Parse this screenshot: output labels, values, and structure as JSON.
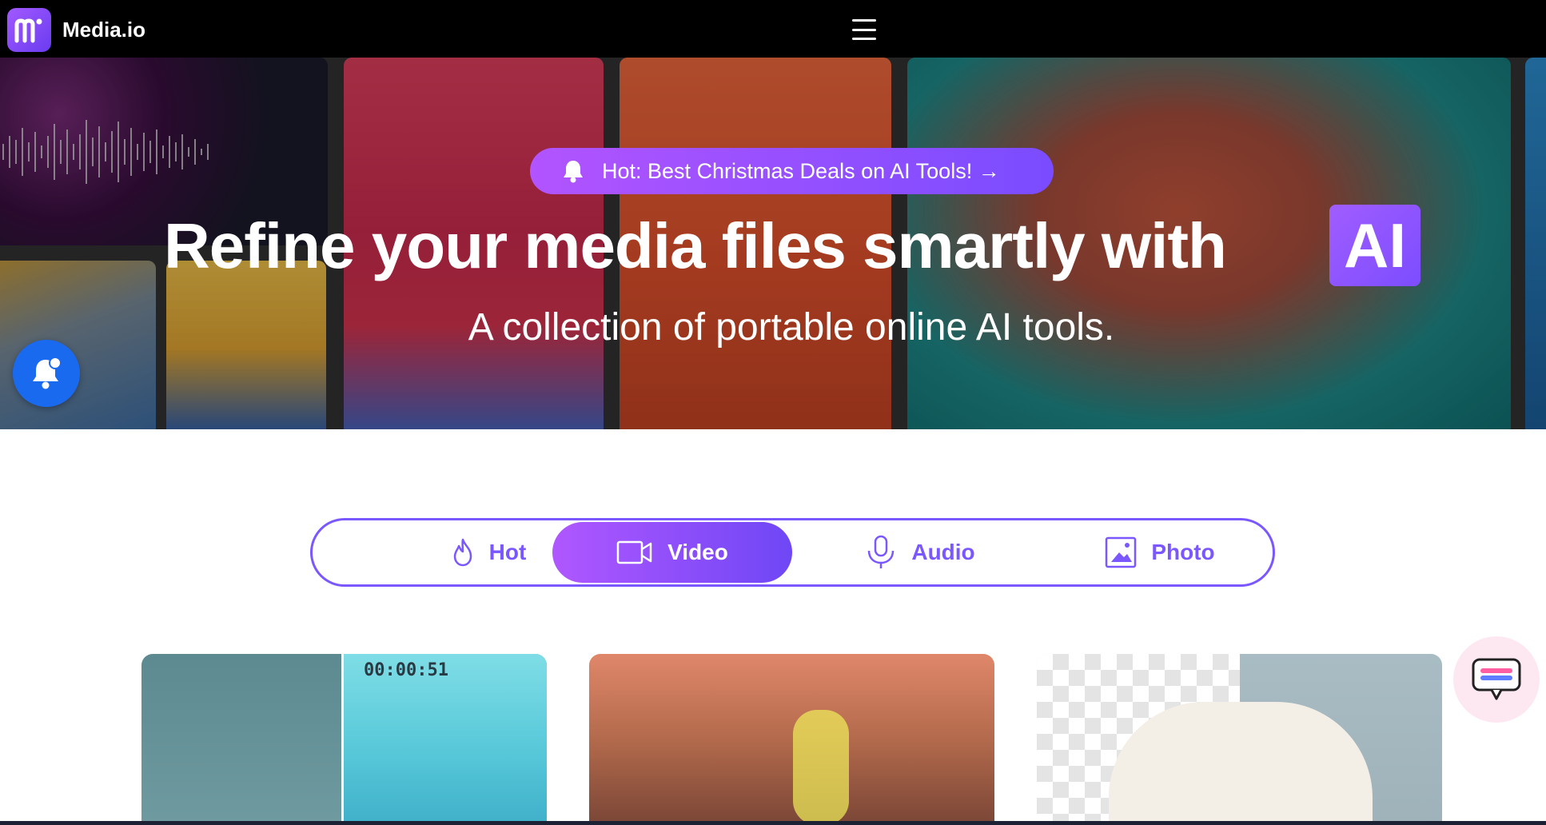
{
  "app": {
    "logo_text": "Media.io"
  },
  "hero": {
    "promo_text": "Hot: Best Christmas Deals on AI Tools! →",
    "headline": "Refine your media files smartly with",
    "headline_accent": "AI",
    "subtitle": "A collection of portable online AI tools."
  },
  "tabs": [
    {
      "label": "Hot",
      "icon": "flame-icon",
      "active": false
    },
    {
      "label": "Video",
      "icon": "video-camera-icon",
      "active": true
    },
    {
      "label": "Audio",
      "icon": "microphone-icon",
      "active": false
    },
    {
      "label": "Photo",
      "icon": "image-icon",
      "active": false
    }
  ],
  "cards": [
    {
      "timecode": "00:00:51"
    },
    {},
    {}
  ],
  "colors": {
    "accent": "#7b57ff",
    "gradient_start": "#b057ff",
    "gradient_end": "#6f47f5",
    "notify_button": "#1a6af0",
    "topbar": "#000000"
  }
}
